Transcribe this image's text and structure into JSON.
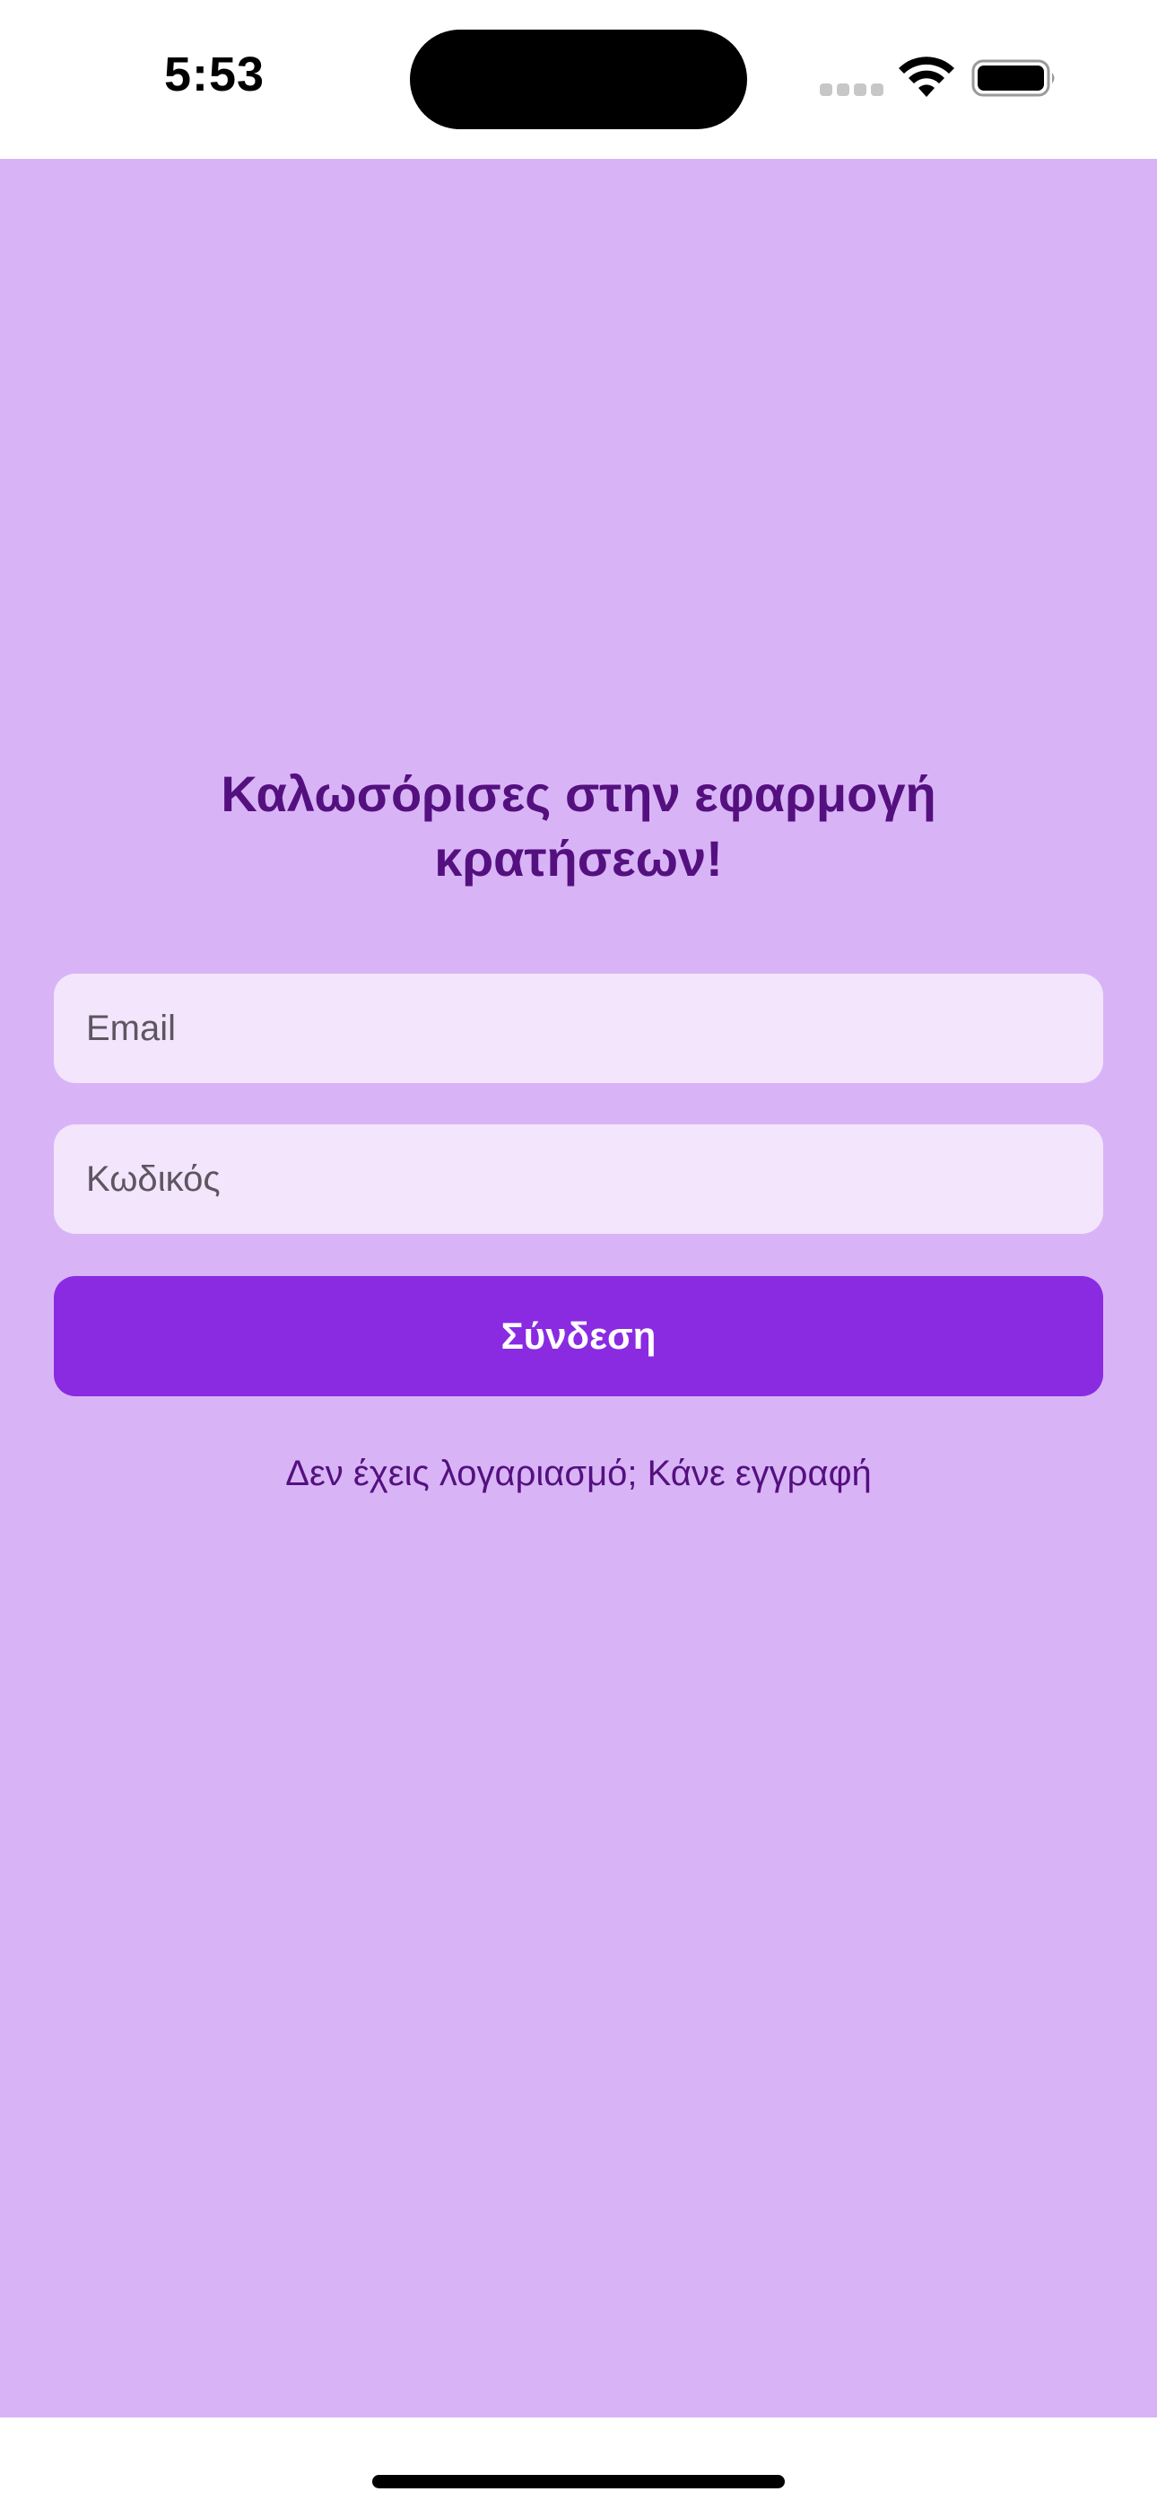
{
  "status_bar": {
    "time": "5:53",
    "icons": [
      "cellular-signal-icon",
      "wifi-icon",
      "battery-icon"
    ]
  },
  "login": {
    "title": "Καλωσόρισες στην εφαρμογή κρατήσεων!",
    "email_placeholder": "Email",
    "email_value": "",
    "password_placeholder": "Κωδικός",
    "password_value": "",
    "login_button": "Σύνδεση",
    "register_link": "Δεν έχεις λογαριασμό; Κάνε εγγραφή"
  },
  "colors": {
    "background": "#d8b4f7",
    "title": "#55107f",
    "input_background": "#f3e5fc",
    "button": "#8a2be2",
    "button_text": "#ffffff"
  }
}
